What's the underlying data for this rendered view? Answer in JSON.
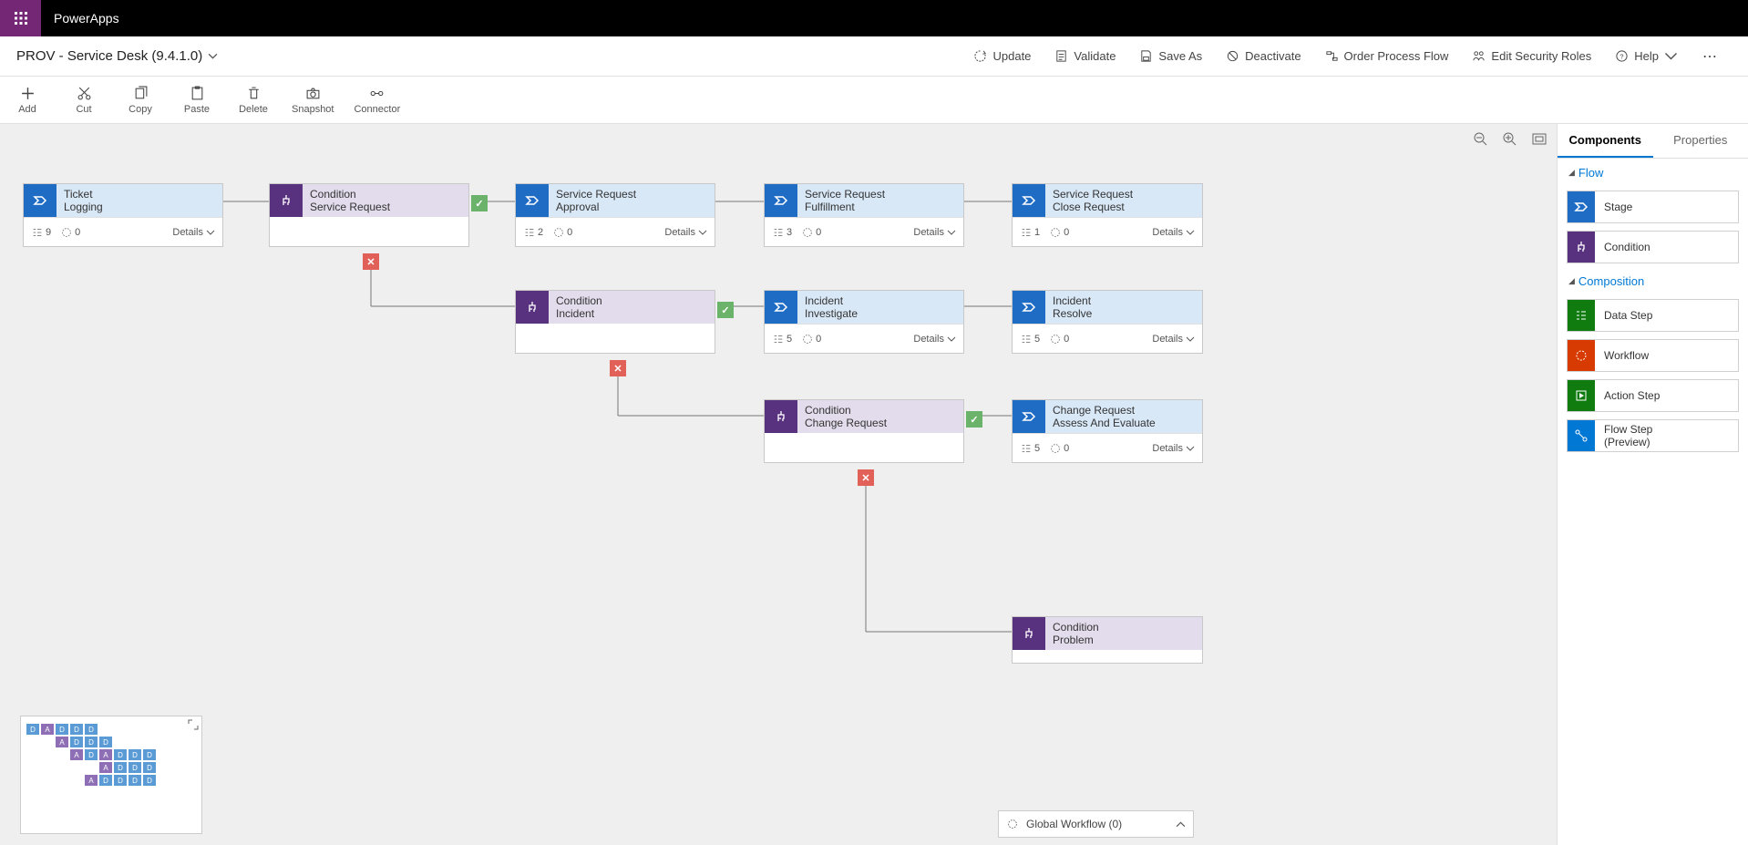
{
  "brand": "PowerApps",
  "page_title": "PROV - Service Desk (9.4.1.0)",
  "commands": {
    "update": "Update",
    "validate": "Validate",
    "saveas": "Save As",
    "deactivate": "Deactivate",
    "order": "Order Process Flow",
    "security": "Edit Security Roles",
    "help": "Help"
  },
  "toolbar": {
    "add": "Add",
    "cut": "Cut",
    "copy": "Copy",
    "paste": "Paste",
    "delete": "Delete",
    "snapshot": "Snapshot",
    "connector": "Connector"
  },
  "right_panel": {
    "tab_components": "Components",
    "tab_properties": "Properties",
    "grp_flow": "Flow",
    "grp_composition": "Composition",
    "stage": "Stage",
    "condition": "Condition",
    "datastep": "Data Step",
    "workflow": "Workflow",
    "actionstep": "Action Step",
    "flowstep": "Flow Step\n(Preview)"
  },
  "details_label": "Details",
  "global_workflow": "Global Workflow (0)",
  "nodes": {
    "ticket": {
      "l1": "Ticket",
      "l2": "Logging",
      "steps": "9",
      "wf": "0"
    },
    "cond_sr": {
      "l1": "Condition",
      "l2": "Service Request"
    },
    "sr_approval": {
      "l1": "Service Request",
      "l2": "Approval",
      "steps": "2",
      "wf": "0"
    },
    "sr_fulfil": {
      "l1": "Service Request",
      "l2": "Fulfillment",
      "steps": "3",
      "wf": "0"
    },
    "sr_close": {
      "l1": "Service Request",
      "l2": "Close Request",
      "steps": "1",
      "wf": "0"
    },
    "cond_inc": {
      "l1": "Condition",
      "l2": "Incident"
    },
    "inc_inv": {
      "l1": "Incident",
      "l2": "Investigate",
      "steps": "5",
      "wf": "0"
    },
    "inc_res": {
      "l1": "Incident",
      "l2": "Resolve",
      "steps": "5",
      "wf": "0"
    },
    "cond_cr": {
      "l1": "Condition",
      "l2": "Change Request"
    },
    "cr_assess": {
      "l1": "Change Request",
      "l2": "Assess And Evaluate",
      "steps": "5",
      "wf": "0"
    },
    "cond_prob": {
      "l1": "Condition",
      "l2": "Problem"
    }
  }
}
